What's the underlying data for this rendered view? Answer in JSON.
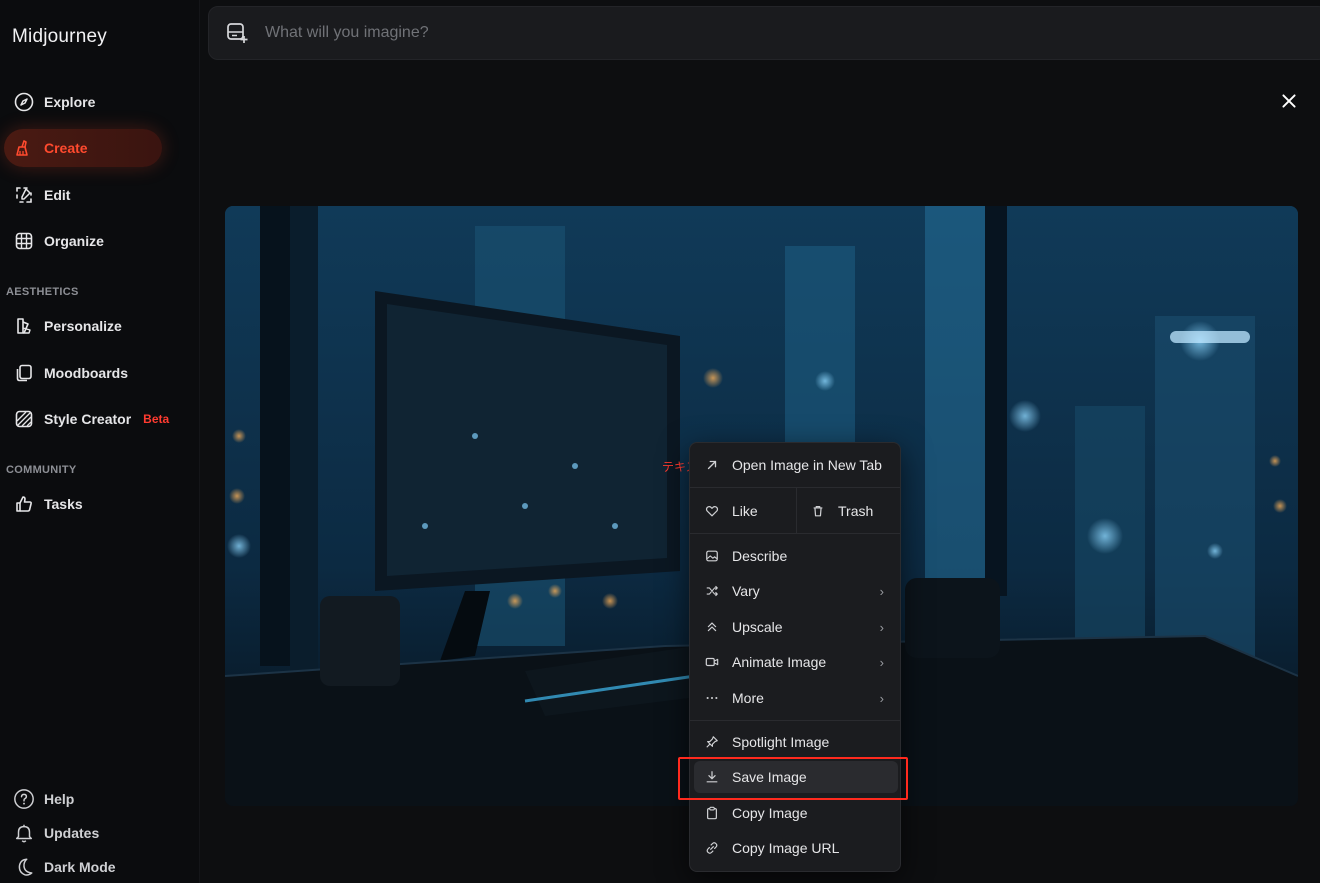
{
  "app": {
    "brand": "Midjourney"
  },
  "prompt": {
    "placeholder": "What will you imagine?"
  },
  "sidebar": {
    "items": [
      {
        "label": "Explore",
        "icon": "compass-icon"
      },
      {
        "label": "Create",
        "icon": "brush-icon",
        "active": true
      },
      {
        "label": "Edit",
        "icon": "edit-icon"
      },
      {
        "label": "Organize",
        "icon": "grid-icon"
      }
    ],
    "aesthetics_title": "AESTHETICS",
    "aesthetics": [
      {
        "label": "Personalize",
        "icon": "personalize-icon"
      },
      {
        "label": "Moodboards",
        "icon": "moodboard-icon"
      },
      {
        "label": "Style Creator",
        "icon": "style-icon",
        "badge": "Beta"
      }
    ],
    "community_title": "COMMUNITY",
    "community": [
      {
        "label": "Tasks",
        "icon": "thumbs-up-icon"
      }
    ],
    "bottom": [
      {
        "label": "Help",
        "icon": "help-icon"
      },
      {
        "label": "Updates",
        "icon": "bell-icon"
      },
      {
        "label": "Dark Mode",
        "icon": "moon-icon"
      }
    ]
  },
  "context_menu": {
    "open_new_tab": "Open Image in New Tab",
    "like": "Like",
    "trash": "Trash",
    "describe": "Describe",
    "vary": "Vary",
    "upscale": "Upscale",
    "animate": "Animate Image",
    "more": "More",
    "spotlight": "Spotlight Image",
    "save": "Save Image",
    "copy_image": "Copy Image",
    "copy_url": "Copy Image URL",
    "chevron": "›"
  },
  "annotation": {
    "overlay_text": "テキスト"
  },
  "colors": {
    "accent": "#ff4a2e",
    "highlight_box": "#ff2a1e",
    "menu_bg": "#1b1c1f"
  }
}
